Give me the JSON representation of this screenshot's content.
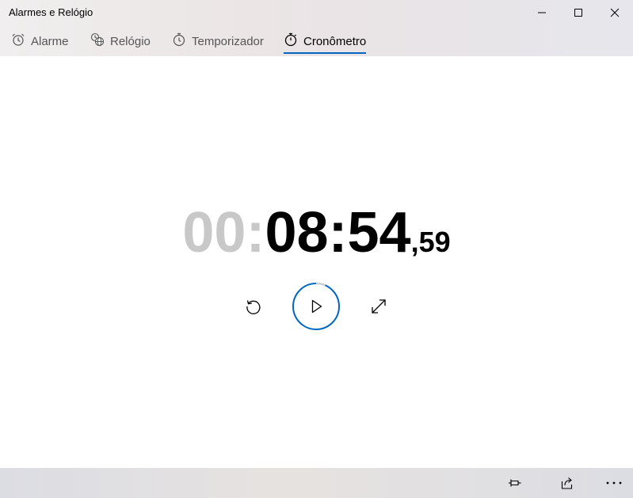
{
  "window": {
    "title": "Alarmes e Relógio"
  },
  "tabs": [
    {
      "label": "Alarme",
      "icon": "alarm-clock-icon",
      "active": false
    },
    {
      "label": "Relógio",
      "icon": "world-clock-icon",
      "active": false
    },
    {
      "label": "Temporizador",
      "icon": "timer-icon",
      "active": false
    },
    {
      "label": "Cronômetro",
      "icon": "stopwatch-icon",
      "active": true
    }
  ],
  "stopwatch": {
    "hours": "00",
    "separator": ":",
    "minutes_seconds": "08:54",
    "fraction": ",59"
  },
  "controls": {
    "reset_icon": "reset-icon",
    "play_icon": "play-icon",
    "expand_icon": "expand-icon"
  },
  "bottom_bar": {
    "pin_icon": "pin-icon",
    "share_icon": "share-icon",
    "more_icon": "more-icon"
  },
  "colors": {
    "accent": "#0067c0",
    "hours_dim": "#c8c8c8",
    "text": "#000000"
  }
}
